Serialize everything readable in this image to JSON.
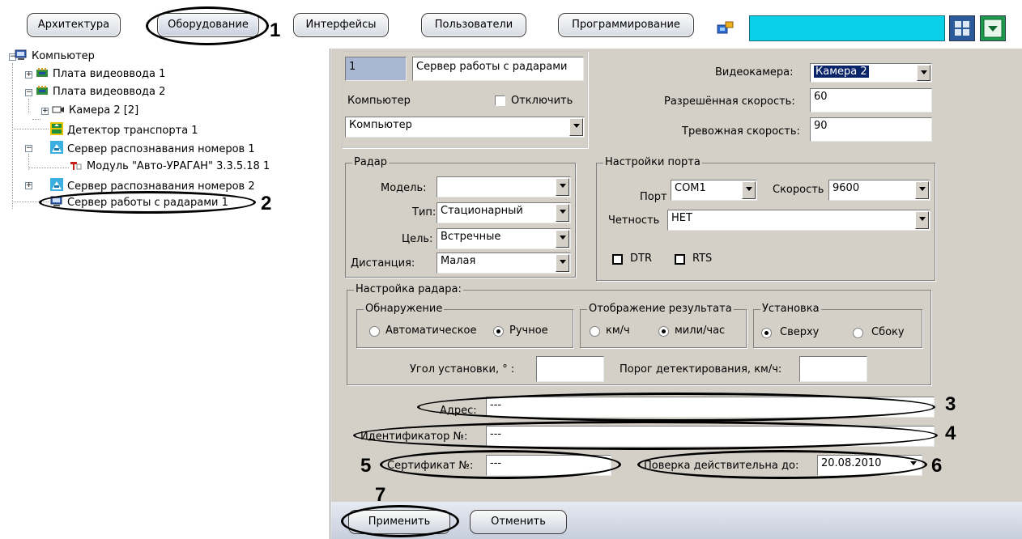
{
  "toolbar": {
    "tabs": [
      "Архитектура",
      "Оборудование",
      "Интерфейсы",
      "Пользователи",
      "Программирование"
    ],
    "tab_callout": "1"
  },
  "tree": {
    "items": [
      "Компьютер",
      "Плата видеоввода 1",
      "Плата видеоввода 2",
      "Камера 2 [2]",
      "Детектор транспорта 1",
      "Сервер распознавания номеров 1",
      "Модуль \"Авто-УРАГАН\" 3.3.5.18 1",
      "Сервер распознавания номеров 2",
      "Сервер работы с радарами 1"
    ],
    "callout": "2"
  },
  "object": {
    "id": "1",
    "name": "Сервер работы с радарами",
    "computer_label": "Компьютер",
    "disable_label": "Отключить",
    "computer_value": "Компьютер"
  },
  "camera": {
    "camera_label": "Видеокамера:",
    "camera_value": "Камера 2",
    "allowed_speed_label": "Разрешённая скорость:",
    "allowed_speed_value": "60",
    "alarm_speed_label": "Тревожная скорость:",
    "alarm_speed_value": "90"
  },
  "radar": {
    "title": "Радар",
    "model_label": "Модель:",
    "model_value": "",
    "type_label": "Тип:",
    "type_value": "Стационарный",
    "target_label": "Цель:",
    "target_value": "Встречные",
    "distance_label": "Дистанция:",
    "distance_value": "Малая"
  },
  "port": {
    "title": "Настройки порта",
    "port_label": "Порт",
    "port_value": "COM1",
    "speed_label": "Скорость",
    "speed_value": "9600",
    "parity_label": "Четность",
    "parity_value": "НЕТ",
    "dtr_label": "DTR",
    "rts_label": "RTS"
  },
  "radar_setup": {
    "title": "Настройка радара:",
    "detection_title": "Обнаружение",
    "auto_label": "Автоматическое",
    "manual_label": "Ручное",
    "display_title": "Отображение результата",
    "kmh_label": "км/ч",
    "mph_label": "мили/час",
    "mount_title": "Установка",
    "top_label": "Сверху",
    "side_label": "Сбоку",
    "angle_label": "Угол установки, ° :",
    "angle_value": "",
    "threshold_label": "Порог детектирования, км/ч:",
    "threshold_value": ""
  },
  "address": {
    "label": "Адрес:",
    "value": "---",
    "callout": "3"
  },
  "identifier": {
    "label": "Идентификатор №:",
    "value": "---",
    "callout": "4"
  },
  "certificate": {
    "label": "Сертификат №:",
    "value": "---",
    "callout": "5"
  },
  "verification": {
    "label": "Поверка действительна до:",
    "value": "20.08.2010",
    "callout": "6"
  },
  "footer": {
    "apply_label": "Применить",
    "cancel_label": "Отменить",
    "callout": "7"
  },
  "colors": {
    "accent_cyan": "#0ad0e8",
    "panel": "#d4d0c8",
    "selection": "#0a246a"
  }
}
